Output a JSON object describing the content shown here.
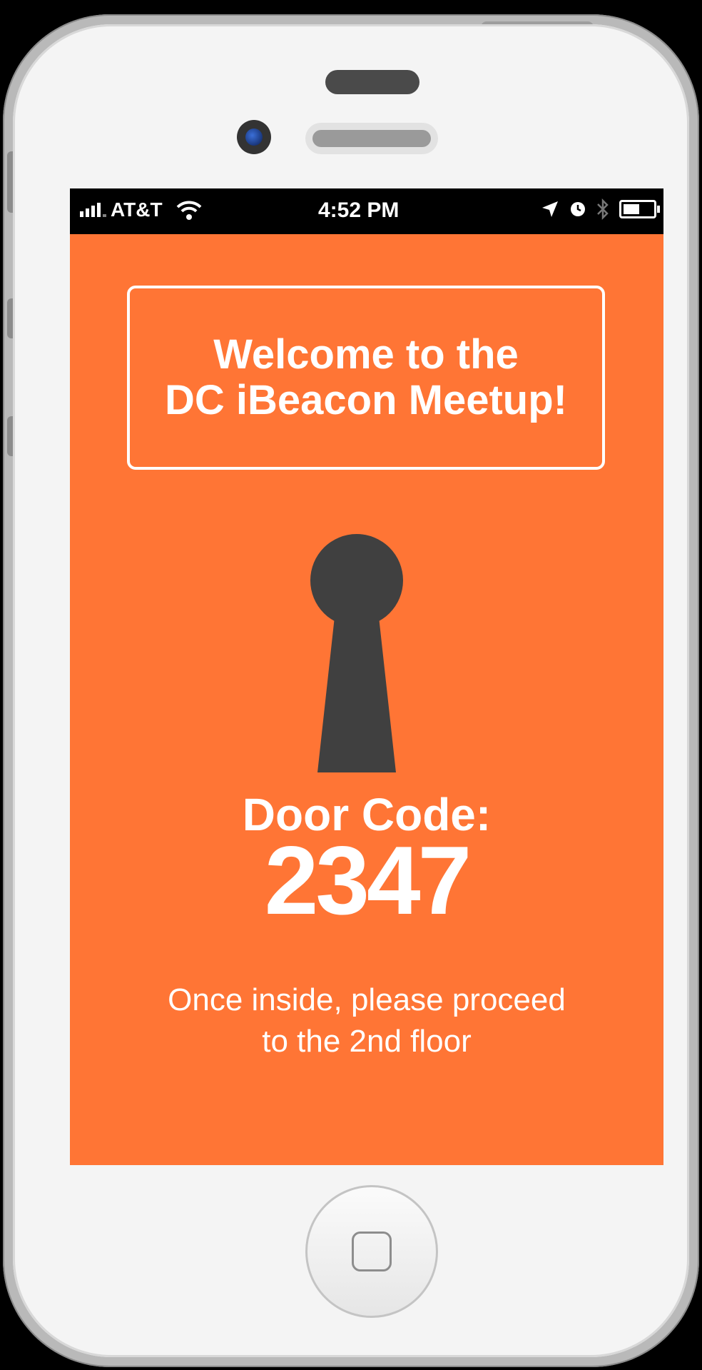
{
  "status_bar": {
    "carrier": "AT&T",
    "time": "4:52 PM",
    "icons": [
      "signal-icon",
      "wifi-icon",
      "location-icon",
      "alarm-icon",
      "bluetooth-icon",
      "battery-icon"
    ]
  },
  "welcome": {
    "line1": "Welcome to the",
    "line2": "DC iBeacon Meetup!"
  },
  "door": {
    "label": "Door Code:",
    "code": "2347"
  },
  "instructions": {
    "line1": "Once inside, please proceed",
    "line2": "to the 2nd floor"
  },
  "colors": {
    "accent": "#ff7535",
    "keyhole": "#404040"
  }
}
